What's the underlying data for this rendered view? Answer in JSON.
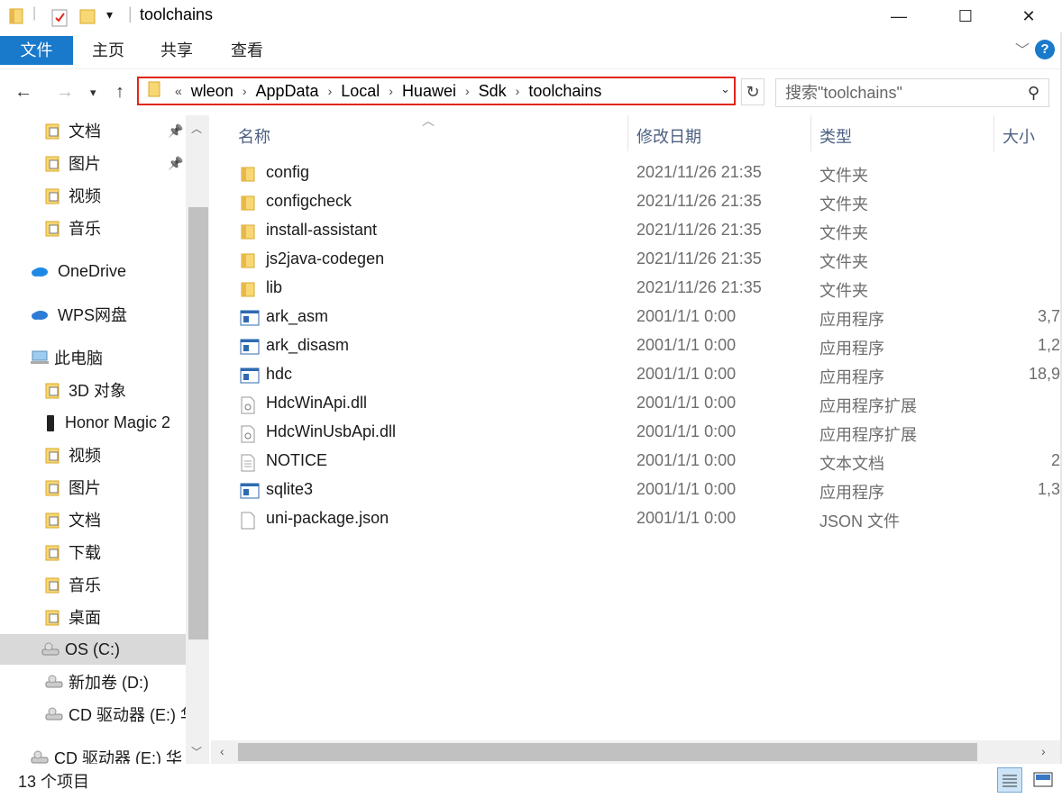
{
  "window": {
    "title": "toolchains",
    "controls": {
      "minimize": "—",
      "maximize": "☐",
      "close": "✕"
    }
  },
  "ribbon": {
    "tabs": [
      "文件",
      "主页",
      "共享",
      "查看"
    ],
    "help": "?"
  },
  "address": {
    "overflow": "«",
    "breadcrumbs": [
      "wleon",
      "AppData",
      "Local",
      "Huawei",
      "Sdk",
      "toolchains"
    ],
    "highlight_color": "#e0261b"
  },
  "search": {
    "placeholder": "搜索\"toolchains\""
  },
  "nav": {
    "items": [
      {
        "label": "文档",
        "icon": "documents-icon",
        "pinned": true
      },
      {
        "label": "图片",
        "icon": "pictures-icon",
        "pinned": true
      },
      {
        "label": "视频",
        "icon": "videos-icon"
      },
      {
        "label": "音乐",
        "icon": "music-icon"
      },
      {
        "label": "OneDrive",
        "icon": "onedrive-icon"
      },
      {
        "label": "WPS网盘",
        "icon": "wps-cloud-icon"
      },
      {
        "label": "此电脑",
        "icon": "this-pc-icon"
      },
      {
        "label": "3D 对象",
        "icon": "3d-objects-icon"
      },
      {
        "label": "Honor Magic 2",
        "icon": "phone-icon"
      },
      {
        "label": "视频",
        "icon": "videos-icon"
      },
      {
        "label": "图片",
        "icon": "pictures-icon"
      },
      {
        "label": "文档",
        "icon": "documents-icon"
      },
      {
        "label": "下载",
        "icon": "downloads-icon"
      },
      {
        "label": "音乐",
        "icon": "music-icon"
      },
      {
        "label": "桌面",
        "icon": "desktop-icon"
      },
      {
        "label": "OS (C:)",
        "icon": "drive-c-icon",
        "selected": true
      },
      {
        "label": "新加卷 (D:)",
        "icon": "drive-icon"
      },
      {
        "label": "CD 驱动器 (E:) 华",
        "icon": "cd-drive-icon"
      },
      {
        "label": "CD 驱动器 (E:) 华",
        "icon": "cd-drive-icon"
      }
    ]
  },
  "columns": {
    "name": "名称",
    "date": "修改日期",
    "type": "类型",
    "size": "大小"
  },
  "files": [
    {
      "name": "config",
      "date": "2021/11/26 21:35",
      "type": "文件夹",
      "size": "",
      "icon": "folder-icon"
    },
    {
      "name": "configcheck",
      "date": "2021/11/26 21:35",
      "type": "文件夹",
      "size": "",
      "icon": "folder-icon"
    },
    {
      "name": "install-assistant",
      "date": "2021/11/26 21:35",
      "type": "文件夹",
      "size": "",
      "icon": "folder-icon"
    },
    {
      "name": "js2java-codegen",
      "date": "2021/11/26 21:35",
      "type": "文件夹",
      "size": "",
      "icon": "folder-icon"
    },
    {
      "name": "lib",
      "date": "2021/11/26 21:35",
      "type": "文件夹",
      "size": "",
      "icon": "folder-icon"
    },
    {
      "name": "ark_asm",
      "date": "2001/1/1 0:00",
      "type": "应用程序",
      "size": "3,7",
      "icon": "exe-icon"
    },
    {
      "name": "ark_disasm",
      "date": "2001/1/1 0:00",
      "type": "应用程序",
      "size": "1,2",
      "icon": "exe-icon"
    },
    {
      "name": "hdc",
      "date": "2001/1/1 0:00",
      "type": "应用程序",
      "size": "18,9",
      "icon": "exe-icon"
    },
    {
      "name": "HdcWinApi.dll",
      "date": "2001/1/1 0:00",
      "type": "应用程序扩展",
      "size": "",
      "icon": "dll-icon"
    },
    {
      "name": "HdcWinUsbApi.dll",
      "date": "2001/1/1 0:00",
      "type": "应用程序扩展",
      "size": "",
      "icon": "dll-icon"
    },
    {
      "name": "NOTICE",
      "date": "2001/1/1 0:00",
      "type": "文本文档",
      "size": "2",
      "icon": "text-file-icon"
    },
    {
      "name": "sqlite3",
      "date": "2001/1/1 0:00",
      "type": "应用程序",
      "size": "1,3",
      "icon": "exe-icon"
    },
    {
      "name": "uni-package.json",
      "date": "2001/1/1 0:00",
      "type": "JSON 文件",
      "size": "",
      "icon": "json-file-icon"
    }
  ],
  "status": {
    "item_count": "13 个项目"
  },
  "colors": {
    "accent": "#1979ca",
    "folder": "#f8d775",
    "header_text": "#4d6082"
  }
}
